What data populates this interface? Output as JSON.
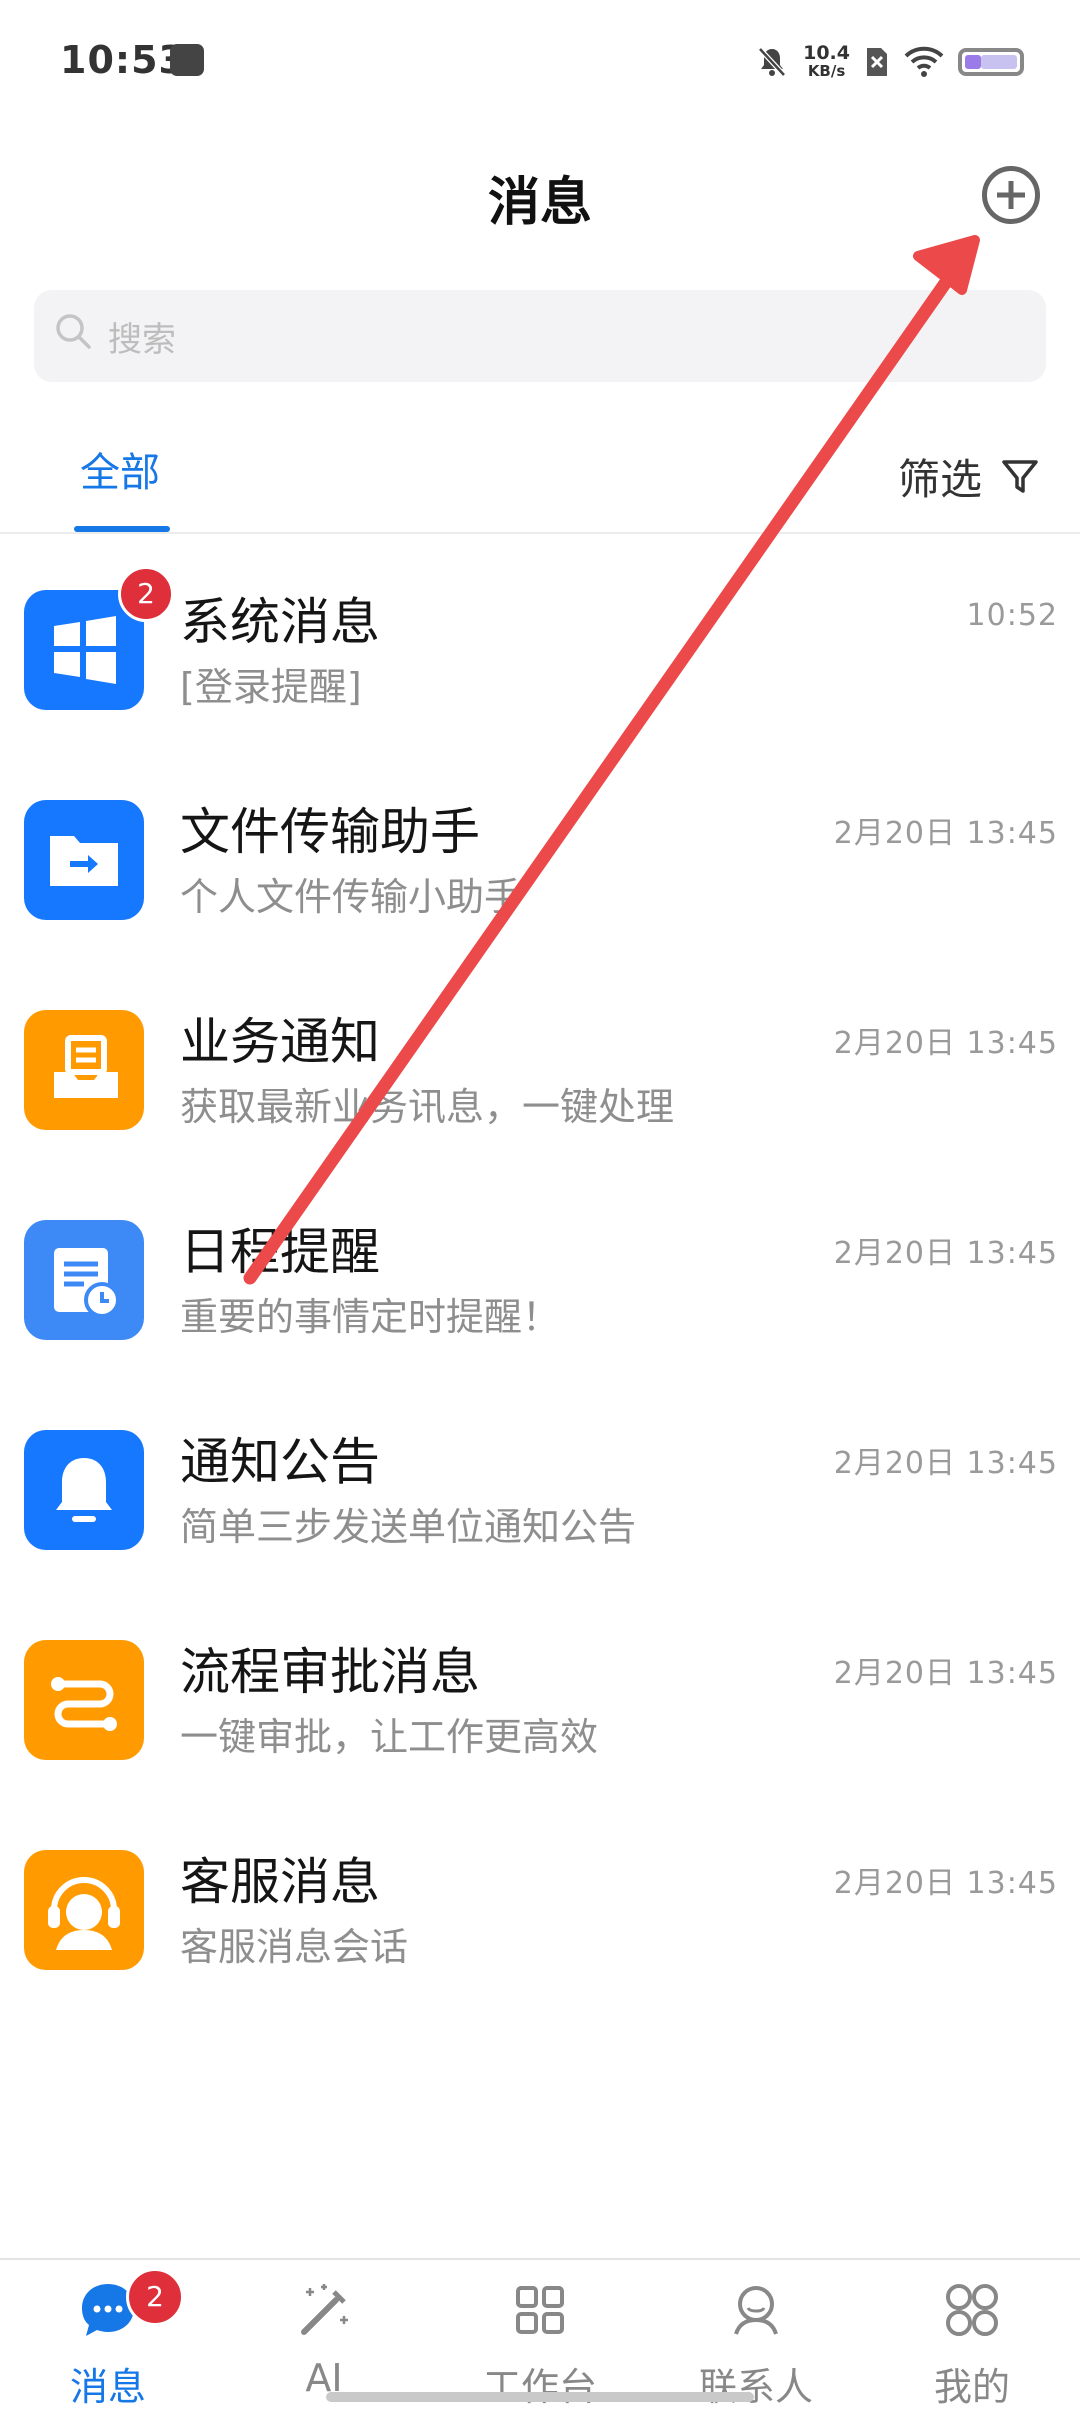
{
  "status_bar": {
    "time": "10:53",
    "net_speed": "10.4",
    "net_unit": "KB/s"
  },
  "header": {
    "title": "消息",
    "add_icon": "plus-circle-icon"
  },
  "search": {
    "placeholder": "搜索"
  },
  "tabs": {
    "all_label": "全部",
    "filter_label": "筛选"
  },
  "messages": [
    {
      "title": "系统消息",
      "subtitle": "[登录提醒]",
      "time": "10:52",
      "badge": "2",
      "icon": "windows-icon",
      "color": "#1677ff"
    },
    {
      "title": "文件传输助手",
      "subtitle": "个人文件传输小助手",
      "time": "2月20日 13:45",
      "icon": "folder-transfer-icon",
      "color": "#1677ff"
    },
    {
      "title": "业务通知",
      "subtitle": "获取最新业务讯息，一键处理",
      "time": "2月20日 13:45",
      "icon": "inbox-tray-icon",
      "color": "#ff9a00"
    },
    {
      "title": "日程提醒",
      "subtitle": "重要的事情定时提醒！",
      "time": "2月20日 13:45",
      "icon": "calendar-clock-icon",
      "color": "#3d8af7"
    },
    {
      "title": "通知公告",
      "subtitle": "简单三步发送单位通知公告",
      "time": "2月20日 13:45",
      "icon": "bell-icon",
      "color": "#1677ff"
    },
    {
      "title": "流程审批消息",
      "subtitle": "一键审批，让工作更高效",
      "time": "2月20日 13:45",
      "icon": "workflow-icon",
      "color": "#ff9a00"
    },
    {
      "title": "客服消息",
      "subtitle": "客服消息会话",
      "time": "2月20日 13:45",
      "icon": "headset-agent-icon",
      "color": "#ff9a00"
    }
  ],
  "bottom_nav": {
    "items": [
      {
        "label": "消息",
        "icon": "chat-bubble-icon",
        "active": true,
        "badge": "2"
      },
      {
        "label": "AI",
        "icon": "magic-wand-icon"
      },
      {
        "label": "工作台",
        "icon": "grid-icon"
      },
      {
        "label": "联系人",
        "icon": "contact-icon"
      },
      {
        "label": "我的",
        "icon": "clover-icon"
      }
    ]
  },
  "colors": {
    "accent": "#1677e6",
    "badge": "#de2f3a",
    "annotation_arrow": "#ec4a4a"
  }
}
